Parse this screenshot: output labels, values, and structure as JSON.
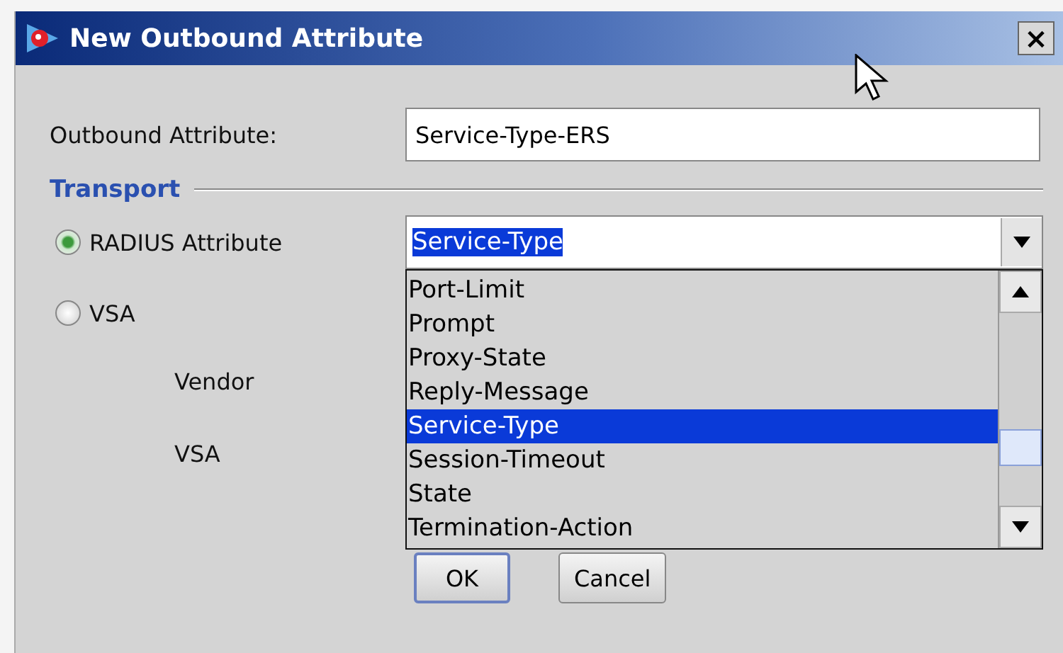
{
  "window": {
    "title": "New Outbound Attribute",
    "close": "×"
  },
  "outbound_attribute": {
    "label": "Outbound Attribute:",
    "value": "Service-Type-ERS"
  },
  "transport": {
    "heading": "Transport",
    "options": [
      {
        "label": "RADIUS Attribute",
        "selected": true
      },
      {
        "label": "VSA",
        "selected": false
      }
    ],
    "dropdown": {
      "value": "Service-Type",
      "items": [
        {
          "label": "Port-Limit",
          "selected": false
        },
        {
          "label": "Prompt",
          "selected": false
        },
        {
          "label": "Proxy-State",
          "selected": false
        },
        {
          "label": "Reply-Message",
          "selected": false
        },
        {
          "label": "Service-Type",
          "selected": true
        },
        {
          "label": "Session-Timeout",
          "selected": false
        },
        {
          "label": "State",
          "selected": false
        },
        {
          "label": "Termination-Action",
          "selected": false
        }
      ]
    },
    "vendor_label": "Vendor",
    "vsa_label": "VSA"
  },
  "buttons": [
    {
      "label": "OK",
      "default": true
    },
    {
      "label": "Cancel",
      "default": false
    }
  ]
}
